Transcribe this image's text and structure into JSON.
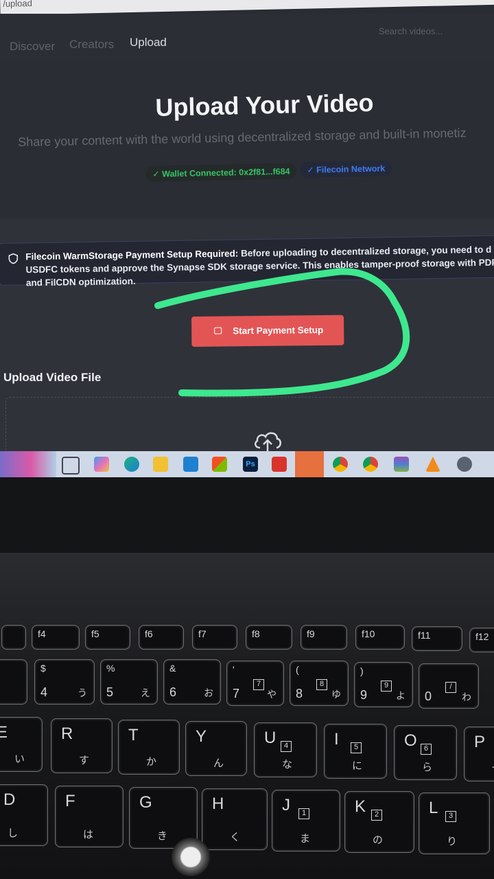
{
  "browser": {
    "url": "/upload"
  },
  "nav": {
    "links": [
      "Discover",
      "Creators",
      "Upload"
    ],
    "search_placeholder": "Search videos..."
  },
  "hero": {
    "title": "Upload Your Video",
    "subtitle": "Share your content with the world using decentralized storage and built-in monetiz",
    "wallet_badge": "✓ Wallet Connected: 0x2f81...f684",
    "network_badge": "✓ Filecoin Network"
  },
  "alert": {
    "title": "Filecoin WarmStorage Payment Setup Required:",
    "line1": "Before uploading to decentralized storage, you need to d",
    "line2": "USDFC tokens and approve the Synapse SDK storage service. This enables tamper-proof storage with PDP",
    "line3": "and FilCDN optimization."
  },
  "payment_button": "Start Payment Setup",
  "upload": {
    "heading": "Upload Video File"
  },
  "colors": {
    "accent_red": "#e35555",
    "success_green": "#37c466",
    "network_blue": "#3f7bf0",
    "annotation_green": "#3ee88e"
  },
  "taskbar_icons": [
    "task-view-icon",
    "copilot-icon",
    "edge-icon",
    "file-explorer-icon",
    "outlook-icon",
    "store-icon",
    "photoshop-icon",
    "wps-icon",
    "opera-icon",
    "chrome-profile-icon",
    "chrome-icon",
    "winrar-icon",
    "vlc-icon",
    "settings-icon"
  ],
  "taskbar_labels": {
    "photoshop": "Ps"
  },
  "keyboard": {
    "fn_row": [
      "f4",
      "f5",
      "f6",
      "f7",
      "f8",
      "f9",
      "f10",
      "f11",
      "f12"
    ],
    "number_row": [
      {
        "sym": "$",
        "num": "4",
        "kana": "う"
      },
      {
        "sym": "%",
        "num": "5",
        "kana": "え"
      },
      {
        "sym": "&",
        "num": "6",
        "kana": "お"
      },
      {
        "sym": "'",
        "num": "7",
        "kana": "や",
        "box": "7"
      },
      {
        "sym": "(",
        "num": "8",
        "kana": "ゆ",
        "box": "8"
      },
      {
        "sym": ")",
        "num": "9",
        "kana": "よ",
        "box": "9"
      },
      {
        "sym": "",
        "num": "0",
        "kana": "わ",
        "box": "/"
      }
    ],
    "top_row": [
      {
        "l": "E",
        "k": "い"
      },
      {
        "l": "R",
        "k": "す"
      },
      {
        "l": "T",
        "k": "か"
      },
      {
        "l": "Y",
        "k": "ん"
      },
      {
        "l": "U",
        "k": "な",
        "box": "4"
      },
      {
        "l": "I",
        "k": "に",
        "box": "5"
      },
      {
        "l": "O",
        "k": "ら",
        "box": "6"
      },
      {
        "l": "P",
        "k": "せ"
      }
    ],
    "home_row": [
      {
        "l": "D",
        "k": "し"
      },
      {
        "l": "F",
        "k": "は"
      },
      {
        "l": "G",
        "k": "き"
      },
      {
        "l": "H",
        "k": "く"
      },
      {
        "l": "J",
        "k": "ま",
        "box": "1"
      },
      {
        "l": "K",
        "k": "の",
        "box": "2"
      },
      {
        "l": "L",
        "k": "り",
        "box": "3"
      }
    ]
  }
}
